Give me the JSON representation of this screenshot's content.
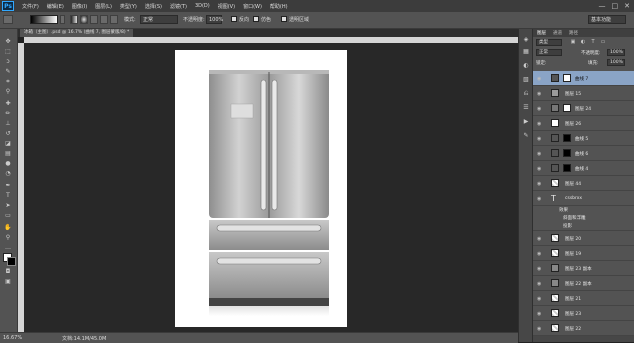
{
  "app": {
    "logo": "Ps"
  },
  "menu": [
    "文件(F)",
    "编辑(E)",
    "图像(I)",
    "图层(L)",
    "类型(Y)",
    "选择(S)",
    "滤镜(T)",
    "3D(D)",
    "视图(V)",
    "窗口(W)",
    "帮助(H)"
  ],
  "window_controls": [
    "—",
    "□",
    "✕"
  ],
  "options": {
    "mode_label": "模式:",
    "mode_value": "正常",
    "opacity_label": "不透明度:",
    "opacity_value": "100%",
    "reverse_label": "反向",
    "dither_label": "仿色",
    "transparency_label": "透明区域",
    "workspace_value": "基本功能"
  },
  "document_tab": "冰箱（主图）.psd @ 16.7% (曲线 7, 图层蒙版/8) *",
  "status": {
    "zoom": "16.67%",
    "doc_info": "文档:14.1M/45.0M"
  },
  "layers_panel": {
    "tabs": [
      "图层",
      "通道",
      "路径"
    ],
    "filter_label": "类型",
    "blend_mode": "正常",
    "opacity_label": "不透明度:",
    "opacity_value": "100%",
    "lock_label": "锁定:",
    "fill_label": "填充:",
    "fill_value": "100%",
    "layers": [
      {
        "name": "曲线 7",
        "selected": true
      },
      {
        "name": "图层 15"
      },
      {
        "name": "图层 24"
      },
      {
        "name": "图层 26"
      },
      {
        "name": "曲线 5"
      },
      {
        "name": "曲线 6"
      },
      {
        "name": "曲线 4"
      },
      {
        "name": "图层 44"
      },
      {
        "name": "cssbrxx"
      },
      {
        "name": "效果"
      },
      {
        "name": "斜面和浮雕"
      },
      {
        "name": "投影"
      },
      {
        "name": "图层 20"
      },
      {
        "name": "图层 19"
      },
      {
        "name": "图层 23 副本"
      },
      {
        "name": "图层 22 副本"
      },
      {
        "name": "图层 21"
      },
      {
        "name": "图层 23"
      },
      {
        "name": "图层 22"
      }
    ]
  }
}
